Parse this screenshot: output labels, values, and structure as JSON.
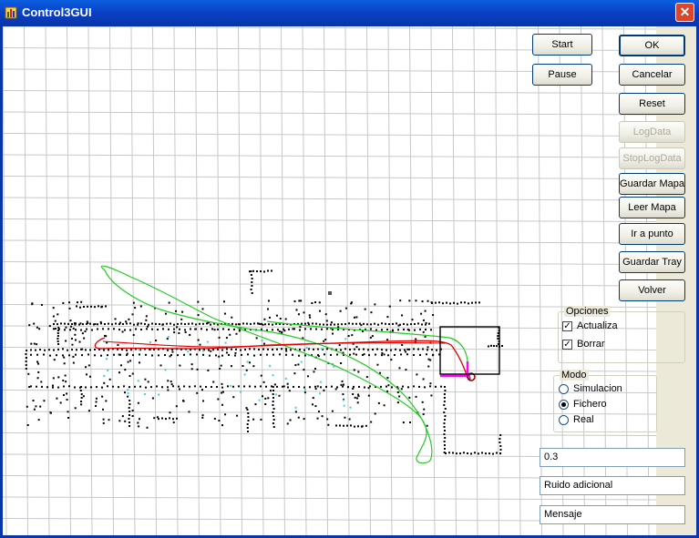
{
  "window": {
    "title": "Control3GUI"
  },
  "buttons": {
    "start": "Start",
    "pause": "Pause",
    "ok": "OK",
    "cancel": "Cancelar",
    "reset": "Reset",
    "logdata": "LogData",
    "stoplogdata": "StopLogData",
    "guardar_mapa": "Guardar Mapa",
    "leer_mapa": "Leer Mapa",
    "ir_a_punto": "Ir a punto",
    "guardar_tray": "Guardar Tray",
    "volver": "Volver"
  },
  "opciones": {
    "title": "Opciones",
    "actualiza": {
      "label": "Actualiza",
      "checked": true
    },
    "borrar": {
      "label": "Borrar",
      "checked": true
    }
  },
  "modo": {
    "title": "Modo",
    "options": [
      "Simulacion",
      "Fichero",
      "Real"
    ],
    "selected": "Fichero"
  },
  "fields": {
    "value": "0.3",
    "noise": "Ruido adicional",
    "message": "Mensaje"
  },
  "colors": {
    "path_red": "#e00000",
    "path_green": "#22cc22",
    "robot_magenta": "#ff00ff",
    "scan_cyan": "#40d0e0",
    "grid": "#c8c8c8"
  }
}
